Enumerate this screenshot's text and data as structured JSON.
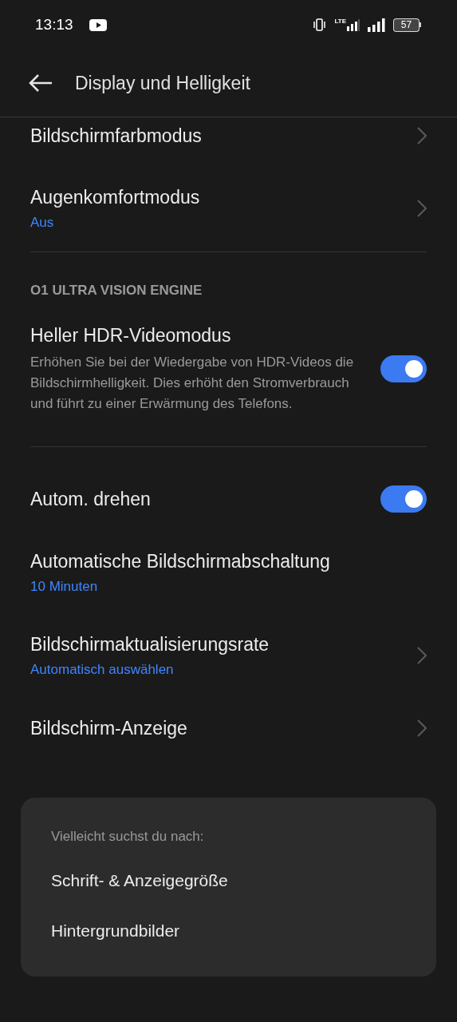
{
  "status_bar": {
    "time": "13:13",
    "network": "LTE",
    "battery": "57"
  },
  "header": {
    "title": "Display und Helligkeit"
  },
  "items": [
    {
      "kind": "nav",
      "title": "Bildschirmfarbmodus"
    },
    {
      "kind": "nav",
      "title": "Augenkomfortmodus",
      "value": "Aus"
    },
    {
      "kind": "divider"
    },
    {
      "kind": "section",
      "title": "O1 ULTRA VISION ENGINE"
    },
    {
      "kind": "toggle",
      "title": "Heller HDR-Videomodus",
      "description": "Erhöhen Sie bei der Wiedergabe von HDR-Videos die Bildschirmhelligkeit. Dies erhöht den Stromverbrauch und führt zu einer Erwärmung des Telefons.",
      "on": true
    },
    {
      "kind": "divider"
    },
    {
      "kind": "toggle",
      "title": "Autom. drehen",
      "on": true
    },
    {
      "kind": "plain",
      "title": "Automatische Bildschirmabschaltung",
      "value": "10 Minuten"
    },
    {
      "kind": "nav",
      "title": "Bildschirmaktualisierungsrate",
      "value": "Automatisch auswählen"
    },
    {
      "kind": "nav",
      "title": "Bildschirm-Anzeige"
    }
  ],
  "suggestions": {
    "heading": "Vielleicht suchst du nach:",
    "items": [
      "Schrift- & Anzeigegröße",
      "Hintergrundbilder"
    ]
  }
}
